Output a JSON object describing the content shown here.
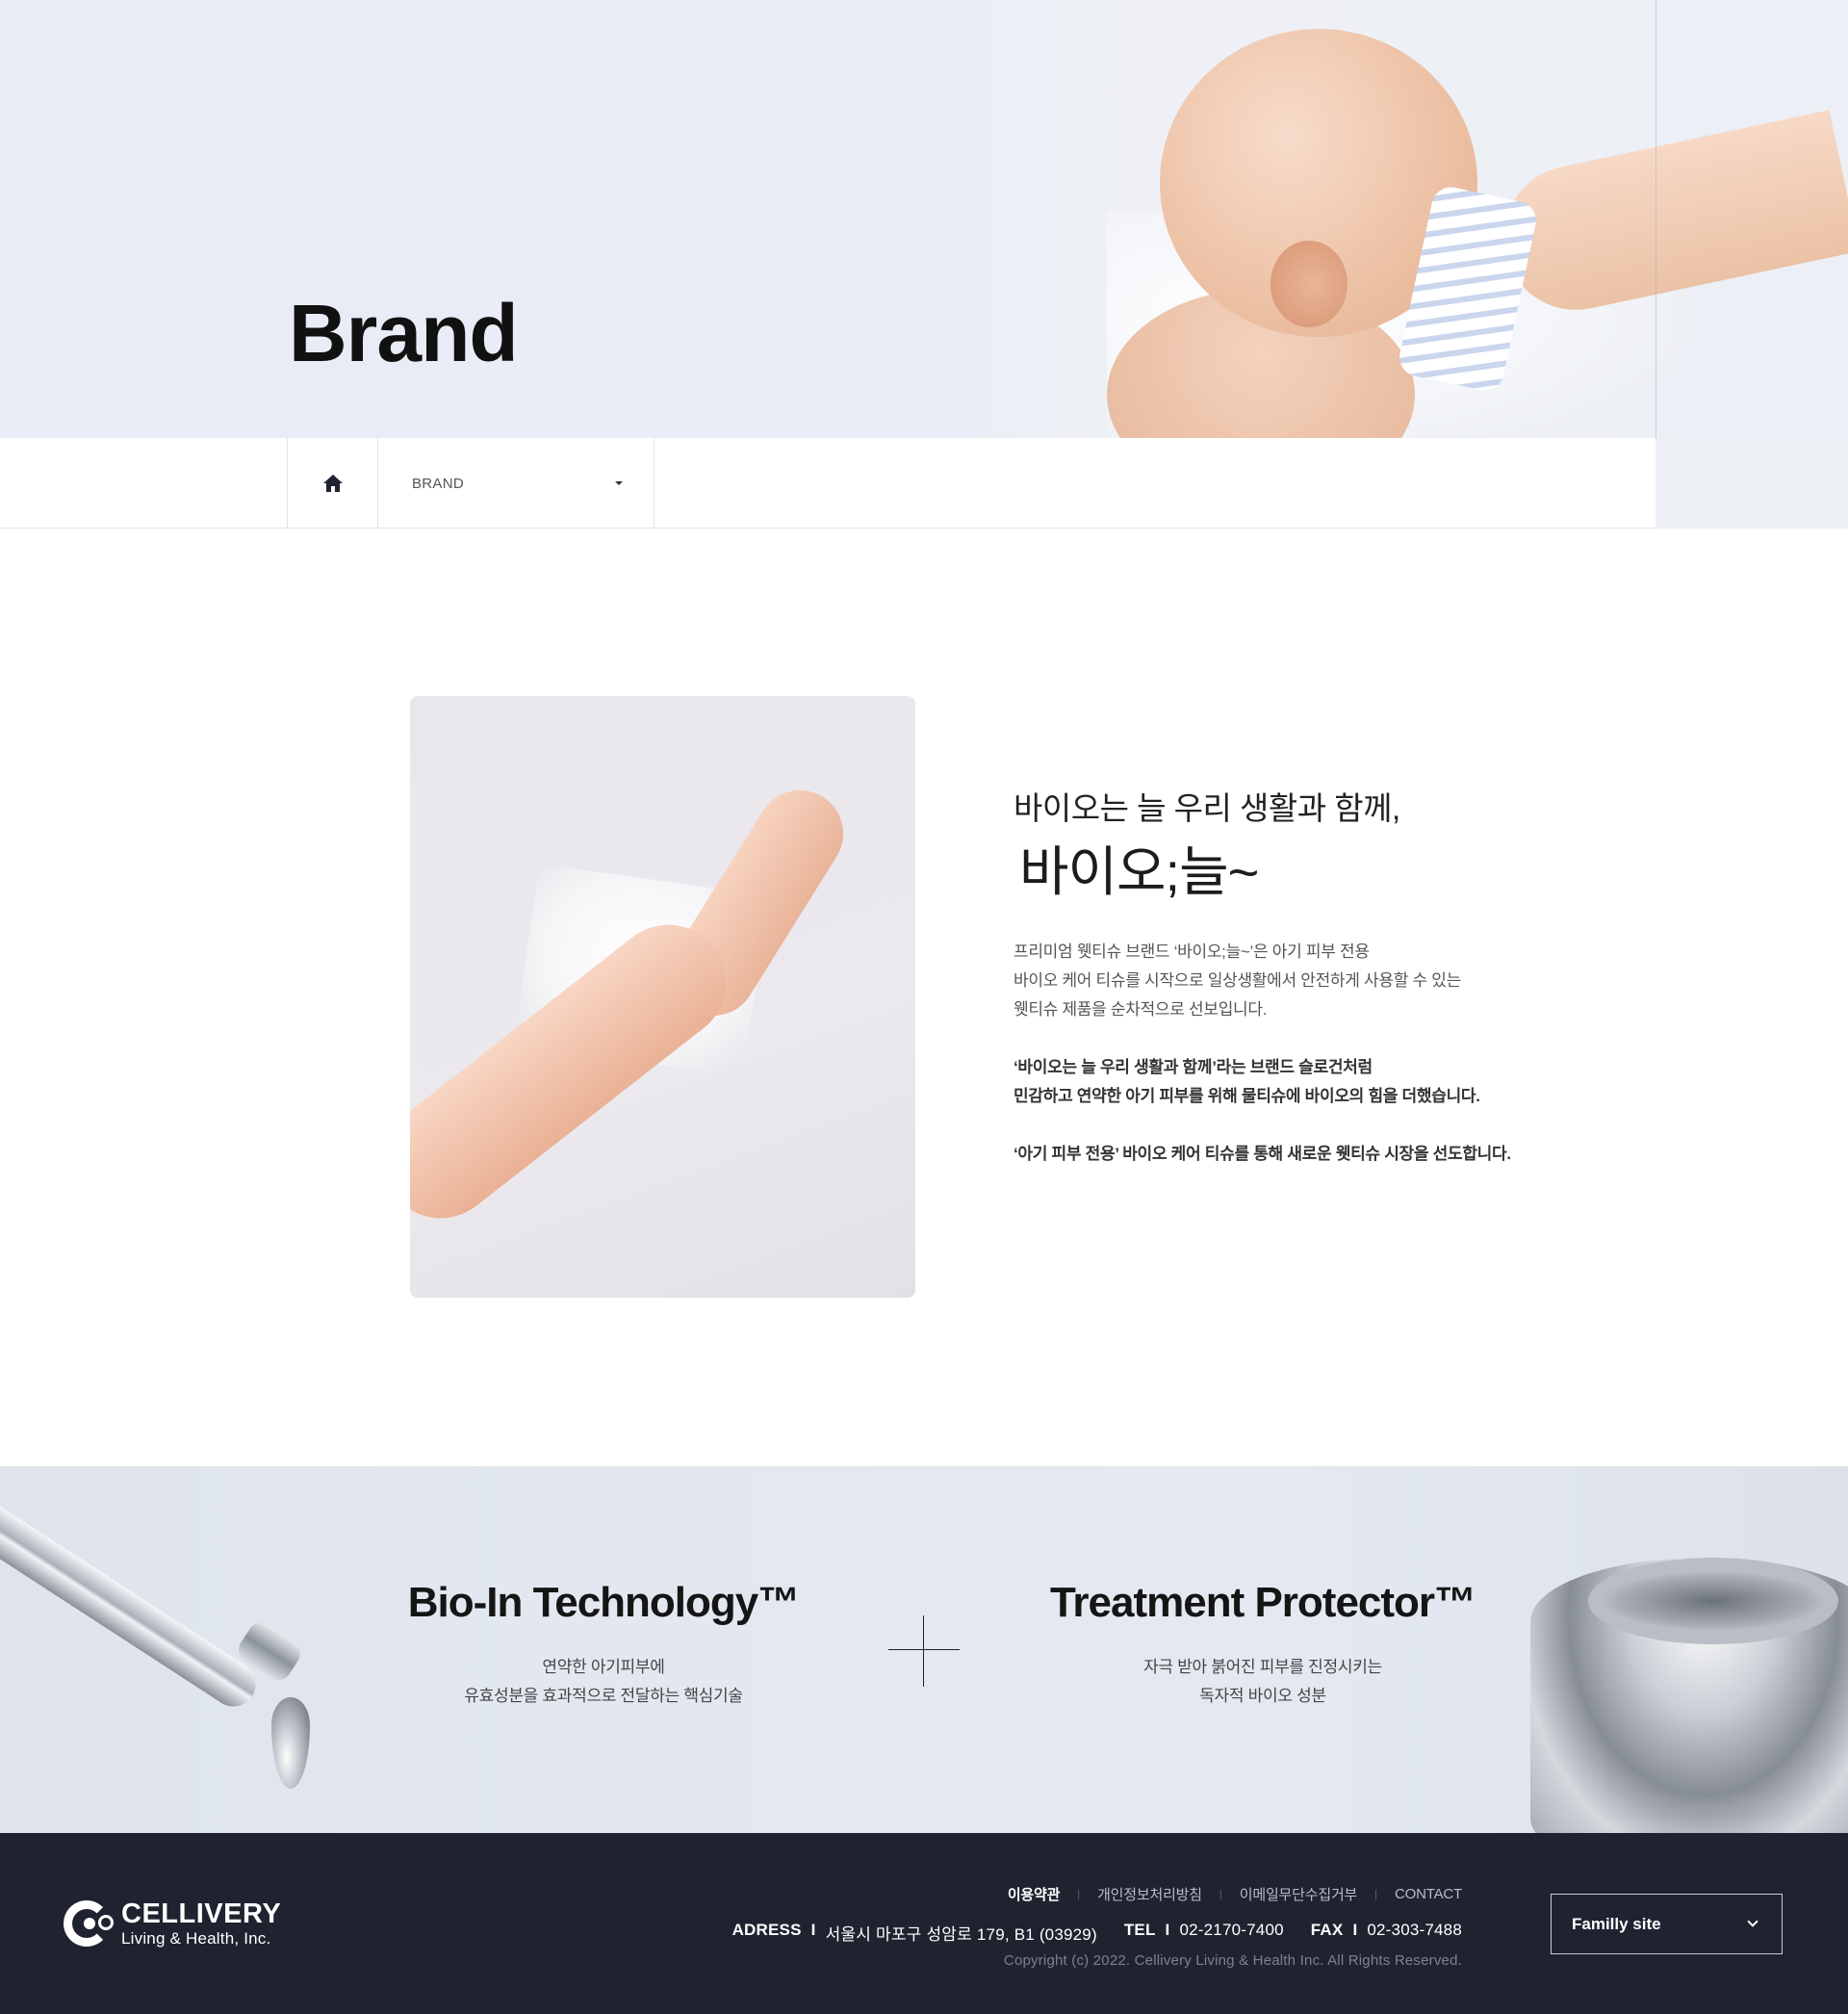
{
  "hero": {
    "title": "Brand"
  },
  "subnav": {
    "home_icon": "home-icon",
    "current_label": "BRAND",
    "dropdown_icon": "caret-down-icon"
  },
  "intro": {
    "lead": "바이오는 늘 우리 생활과 함께,",
    "brand_name": "바이오;늘~",
    "paragraph1": [
      "프리미엄 웻티슈 브랜드 ‘바이오;늘~’은 아기 피부 전용",
      "바이오 케어 티슈를 시작으로 일상생활에서 안전하게 사용할 수 있는",
      "웻티슈 제품을 순차적으로 선보입니다."
    ],
    "paragraph2": [
      "‘바이오는 늘 우리 생활과 함께’라는 브랜드 슬로건처럼",
      "민감하고 연약한 아기 피부를 위해 물티슈에 바이오의 힘을 더했습니다."
    ],
    "paragraph3": "‘아기 피부 전용’ 바이오 케어 티슈를 통해 새로운 웻티슈 시장을 선도합니다."
  },
  "tech": {
    "left": {
      "title": "Bio-In Technology™",
      "desc": [
        "연약한 아기피부에",
        "유효성분을 효과적으로 전달하는 핵심기술"
      ]
    },
    "right": {
      "title": "Treatment Protector™",
      "desc": [
        "자극 받아 붉어진 피부를 진정시키는",
        "독자적 바이오 성분"
      ]
    }
  },
  "footer": {
    "logo_main": "CELLIVERY",
    "logo_sub": "Living & Health, Inc.",
    "links": [
      "이용약관",
      "개인정보처리방침",
      "이메일무단수집거부",
      "CONTACT"
    ],
    "address_label": "ADRESS",
    "address": "서울시 마포구 성암로 179, B1 (03929)",
    "tel_label": "TEL",
    "tel": "02-2170-7400",
    "fax_label": "FAX",
    "fax": "02-303-7488",
    "separator": "I",
    "copyright": "Copyright (c) 2022. Cellivery Living & Health Inc. All Rights Reserved.",
    "family_site": "Familly site"
  },
  "colors": {
    "footer_bg": "#1f2330",
    "highlight": "#c9d7ee",
    "hero_bg": "#e7ecf5"
  }
}
